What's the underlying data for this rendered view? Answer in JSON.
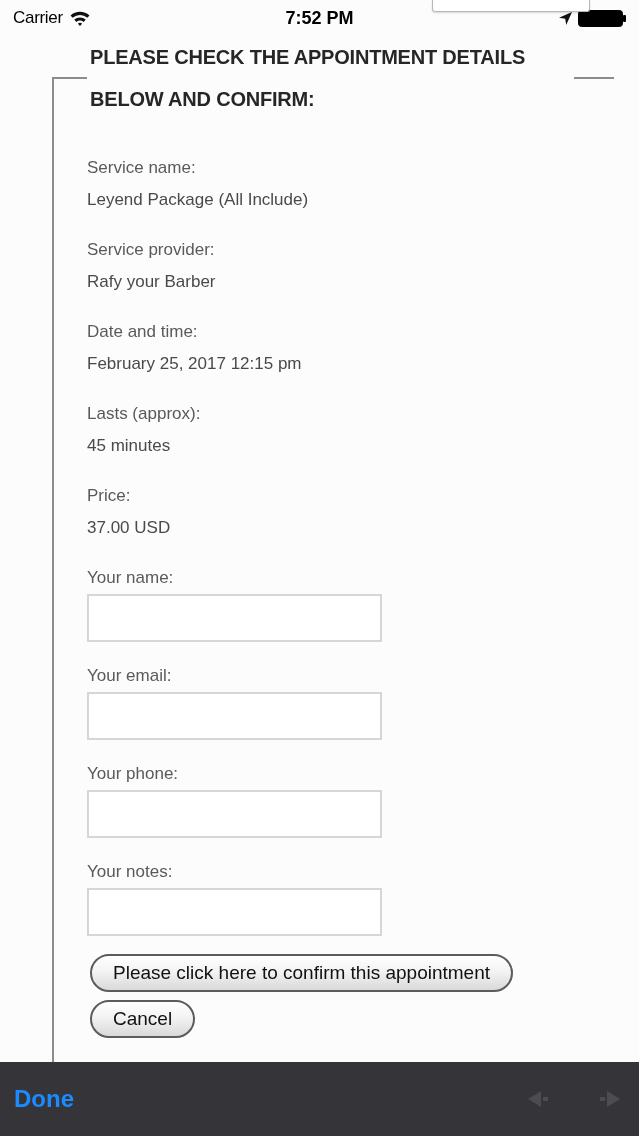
{
  "status_bar": {
    "carrier": "Carrier",
    "time": "7:52 PM"
  },
  "form": {
    "heading": "PLEASE CHECK THE APPOINTMENT DETAILS BELOW AND CONFIRM:",
    "details": [
      {
        "label": "Service name:",
        "value": "Leyend Package (All Include)"
      },
      {
        "label": "Service provider:",
        "value": "Rafy your Barber"
      },
      {
        "label": "Date and time:",
        "value": "February 25, 2017 12:15 pm"
      },
      {
        "label": "Lasts (approx):",
        "value": "45 minutes"
      },
      {
        "label": "Price:",
        "value": "37.00 USD"
      }
    ],
    "fields": [
      {
        "label": "Your name:"
      },
      {
        "label": "Your email:"
      },
      {
        "label": "Your phone:"
      },
      {
        "label": "Your notes:"
      }
    ],
    "buttons": [
      {
        "label": "Please click here to confirm this appointment"
      },
      {
        "label": "Cancel"
      }
    ]
  },
  "keyboard_toolbar": {
    "done": "Done",
    "nav_buttons": [
      {
        "kind": "previous",
        "disabled": true
      },
      {
        "kind": "next",
        "disabled": true
      }
    ]
  }
}
